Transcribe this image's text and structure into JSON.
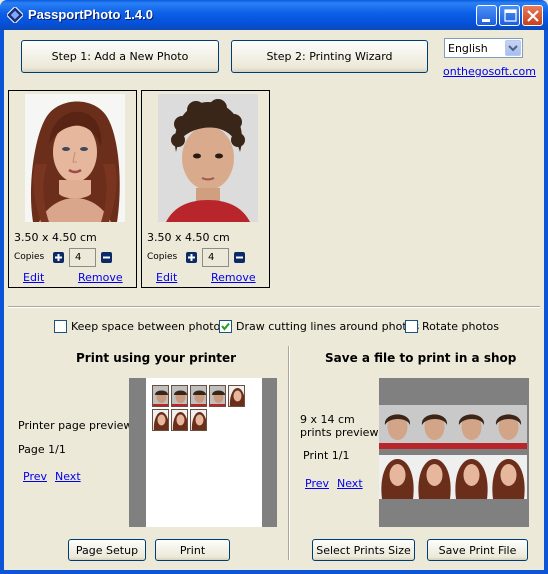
{
  "window": {
    "title": "PassportPhoto 1.4.0",
    "icon": "passport-app-icon",
    "controls": [
      "minimize-icon",
      "maximize-icon",
      "close-icon"
    ]
  },
  "toolbar": {
    "step1_label": "Step 1: Add a New Photo",
    "step2_label": "Step 2: Printing Wizard",
    "language": "English",
    "website_link": "onthegosoft.com"
  },
  "photos": [
    {
      "size": "3.50 x 4.50 cm",
      "copies_label": "Copies",
      "copies": "4",
      "edit": "Edit",
      "remove": "Remove",
      "subject": "woman"
    },
    {
      "size": "3.50 x 4.50 cm",
      "copies_label": "Copies",
      "copies": "4",
      "edit": "Edit",
      "remove": "Remove",
      "subject": "boy"
    }
  ],
  "options": {
    "keep_space": {
      "label": "Keep space between photos",
      "checked": false
    },
    "cutting_lines": {
      "label": "Draw cutting lines around photos",
      "checked": true
    },
    "rotate": {
      "label": "Rotate photos",
      "checked": false
    }
  },
  "printer": {
    "title": "Print using your printer",
    "preview_label": "Printer page preview",
    "page": "Page 1/1",
    "prev": "Prev",
    "next": "Next",
    "page_setup": "Page Setup",
    "print": "Print"
  },
  "shop": {
    "title": "Save a file to print in a shop",
    "size_line1": "9 x 14 cm",
    "size_line2": "prints preview",
    "print_count": "Print  1/1",
    "prev": "Prev",
    "next": "Next",
    "select_size": "Select Prints Size",
    "save_file": "Save Print File"
  },
  "colors": {
    "titlebar": "#0c5fe6",
    "window_bg": "#ece9d8",
    "link": "#0000ee",
    "close_button": "#c8401c"
  }
}
